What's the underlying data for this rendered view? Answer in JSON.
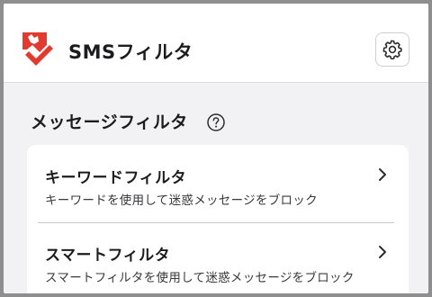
{
  "header": {
    "app_title": "SMSフィルタ",
    "logo_icon": "red-shield-check-logo",
    "settings_icon": "gear-icon"
  },
  "section": {
    "title": "メッセージフィルタ",
    "help_icon": "help-circle-icon"
  },
  "filters": [
    {
      "title": "キーワードフィルタ",
      "description": "キーワードを使用して迷惑メッセージをブロック"
    },
    {
      "title": "スマートフィルタ",
      "description": "スマートフィルタを使用して迷惑メッセージをブロック"
    }
  ],
  "colors": {
    "accent": "#e23a2e",
    "text": "#1c1c1e",
    "background": "#f2f2f4"
  }
}
